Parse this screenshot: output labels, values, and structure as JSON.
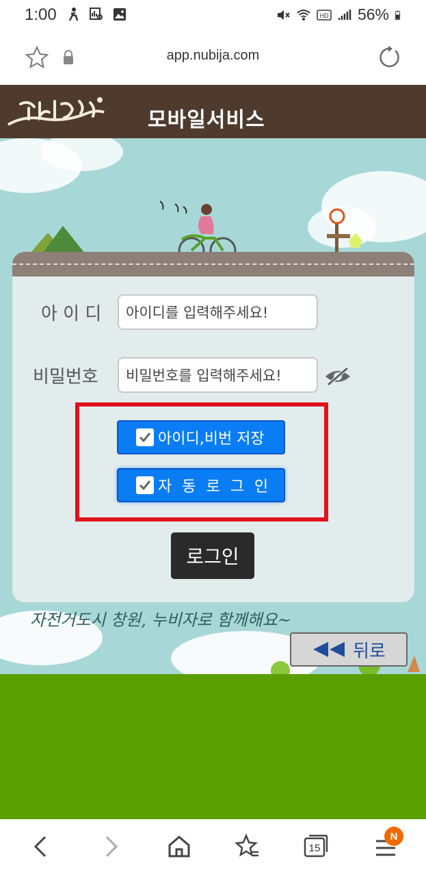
{
  "status_bar": {
    "time": "1:00",
    "battery": "56%"
  },
  "browser": {
    "url": "app.nubija.com",
    "tab_count": "15",
    "menu_badge": "N"
  },
  "header": {
    "logo_text": "누비자",
    "title": "모바일서비스"
  },
  "form": {
    "id_label": "아 이 디",
    "id_placeholder": "아이디를 입력해주세요!",
    "pw_label": "비밀번호",
    "pw_placeholder": "비밀번호를 입력해주세요!",
    "save_id_pw_label": "아이디,비번 저장",
    "auto_login_label": "자 동 로 그 인",
    "login_label": "로그인"
  },
  "slogan": "자전거도시 창원, 누비자로 함께해요~",
  "back_label": "뒤로",
  "colors": {
    "header": "#4e3b2e",
    "button_blue": "#0a7df5",
    "highlight": "#e0121c",
    "grass": "#5a9e00",
    "sky": "#a8d7d8"
  }
}
